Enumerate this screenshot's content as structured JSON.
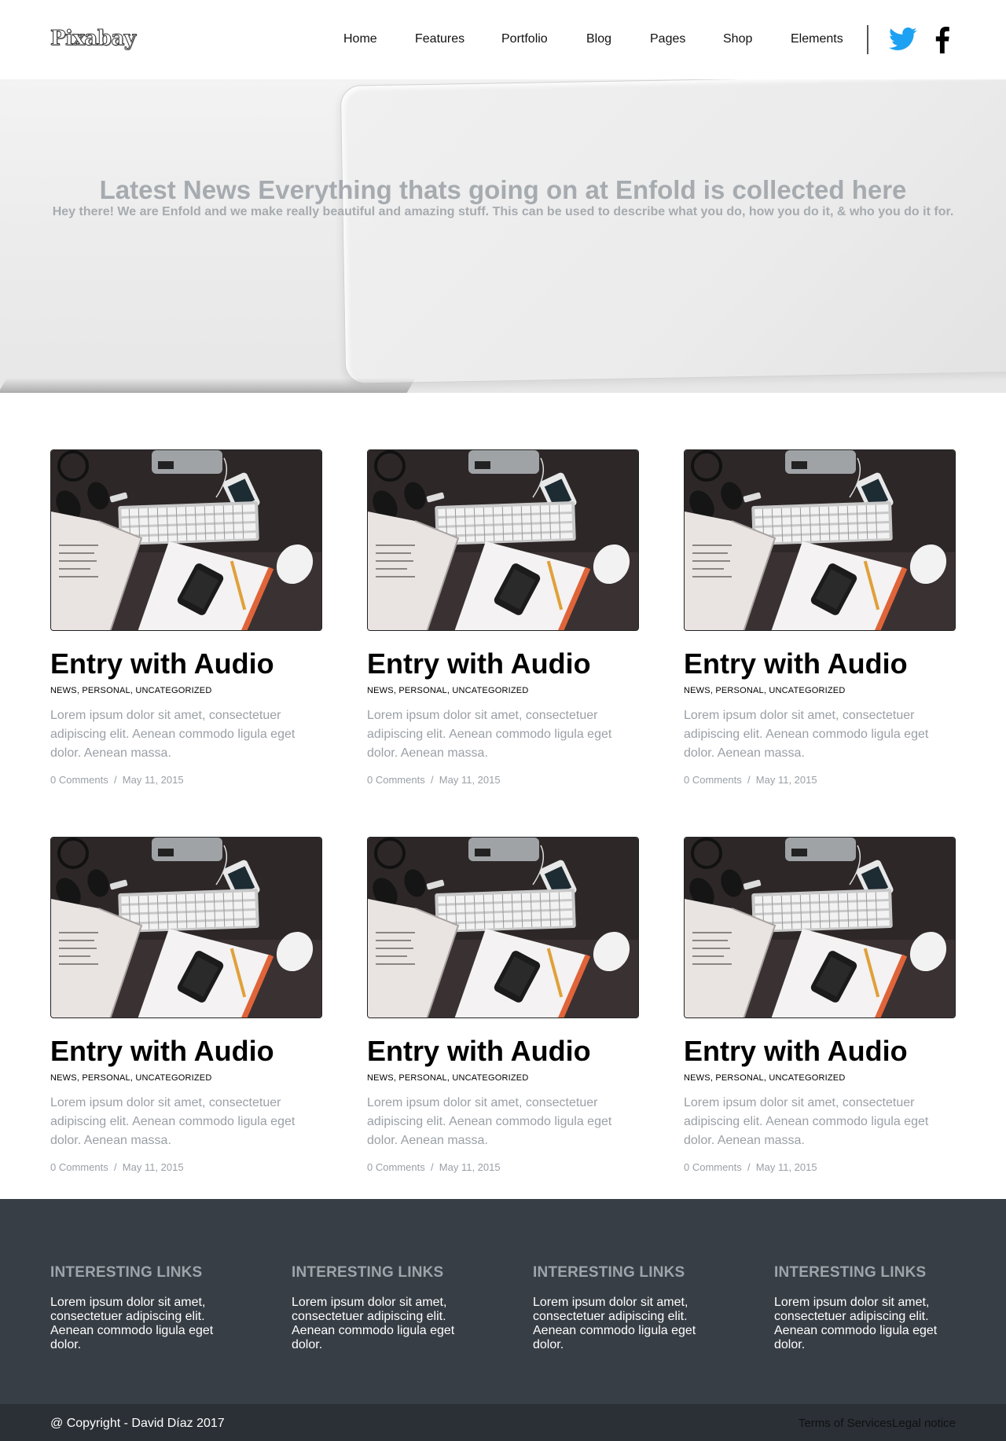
{
  "header": {
    "logo": "Pixabay",
    "nav": [
      "Home",
      "Features",
      "Portfolio",
      "Blog",
      "Pages",
      "Shop",
      "Elements"
    ],
    "social": [
      "twitter-icon",
      "facebook-icon"
    ],
    "twitter_color": "#1da1f2"
  },
  "hero": {
    "title": "Latest News Everything thats going on at Enfold is collected here",
    "subtitle": "Hey there! We are Enfold and we make really beautiful and amazing stuff. This can be used to describe what you do, how you do it, & who you do it for."
  },
  "posts": [
    {
      "title": "Entry with Audio",
      "cats": [
        "News",
        "Personal",
        "Uncategorized"
      ],
      "excerpt": "Lorem ipsum dolor sit amet, consectetuer adipiscing elit. Aenean commodo ligula eget dolor. Aenean massa.",
      "comments": "0 Comments",
      "sep": "/",
      "date": "May 11, 2015"
    },
    {
      "title": "Entry with Audio",
      "cats": [
        "News",
        "Personal",
        "Uncategorized"
      ],
      "excerpt": "Lorem ipsum dolor sit amet, consectetuer adipiscing elit. Aenean commodo ligula eget dolor. Aenean massa.",
      "comments": "0 Comments",
      "sep": "/",
      "date": "May 11, 2015"
    },
    {
      "title": "Entry with Audio",
      "cats": [
        "News",
        "Personal",
        "Uncategorized"
      ],
      "excerpt": "Lorem ipsum dolor sit amet, consectetuer adipiscing elit. Aenean commodo ligula eget dolor. Aenean massa.",
      "comments": "0 Comments",
      "sep": "/",
      "date": "May 11, 2015"
    },
    {
      "title": "Entry with Audio",
      "cats": [
        "News",
        "Personal",
        "Uncategorized"
      ],
      "excerpt": "Lorem ipsum dolor sit amet, consectetuer adipiscing elit. Aenean commodo ligula eget dolor. Aenean massa.",
      "comments": "0 Comments",
      "sep": "/",
      "date": "May 11, 2015"
    },
    {
      "title": "Entry with Audio",
      "cats": [
        "News",
        "Personal",
        "Uncategorized"
      ],
      "excerpt": "Lorem ipsum dolor sit amet, consectetuer adipiscing elit. Aenean commodo ligula eget dolor. Aenean massa.",
      "comments": "0 Comments",
      "sep": "/",
      "date": "May 11, 2015"
    },
    {
      "title": "Entry with Audio",
      "cats": [
        "News",
        "Personal",
        "Uncategorized"
      ],
      "excerpt": "Lorem ipsum dolor sit amet, consectetuer adipiscing elit. Aenean commodo ligula eget dolor. Aenean massa.",
      "comments": "0 Comments",
      "sep": "/",
      "date": "May 11, 2015"
    }
  ],
  "footer": {
    "columns": [
      {
        "heading": "Interesting Links",
        "text": "Lorem ipsum dolor sit amet, consectetuer adipiscing elit. Aenean commodo ligula eget dolor."
      },
      {
        "heading": "Interesting Links",
        "text": "Lorem ipsum dolor sit amet, consectetuer adipiscing elit. Aenean commodo ligula eget dolor."
      },
      {
        "heading": "Interesting Links",
        "text": "Lorem ipsum dolor sit amet, consectetuer adipiscing elit. Aenean commodo ligula eget dolor."
      },
      {
        "heading": "Interesting Links",
        "text": "Lorem ipsum dolor sit amet, consectetuer adipiscing elit. Aenean commodo ligula eget dolor."
      }
    ],
    "copyright": "@ Copyright - David Díaz 2017",
    "terms": "Terms of Services",
    "legal": "Legal notice"
  }
}
